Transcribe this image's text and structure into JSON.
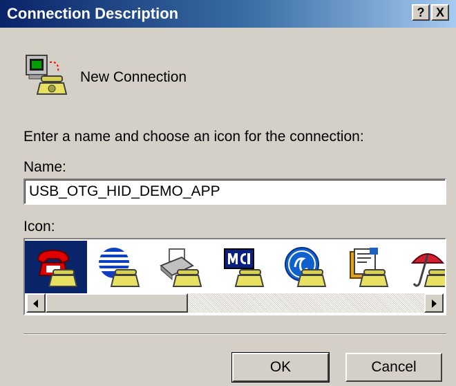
{
  "window": {
    "title": "Connection Description",
    "help_button": "?",
    "close_button": "X"
  },
  "connection": {
    "icon": "computer-phone-icon",
    "name": "New Connection"
  },
  "form": {
    "prompt": "Enter a name and choose an icon for the connection:",
    "name_label": "Name:",
    "name_value": "USB_OTG_HID_DEMO_APP",
    "icon_label": "Icon:"
  },
  "icons": [
    {
      "name": "red-phone-icon",
      "selected": true
    },
    {
      "name": "globe-phone-icon",
      "selected": false
    },
    {
      "name": "fax-phone-icon",
      "selected": false
    },
    {
      "name": "mci-phone-icon",
      "selected": false
    },
    {
      "name": "ge-phone-icon",
      "selected": false
    },
    {
      "name": "documents-phone-icon",
      "selected": false
    },
    {
      "name": "umbrella-phone-icon",
      "selected": false
    }
  ],
  "buttons": {
    "ok": "OK",
    "cancel": "Cancel"
  },
  "colors": {
    "title_bar": "#0a246a",
    "dialog_bg": "#d4d0c8",
    "selection": "#0a246a"
  }
}
